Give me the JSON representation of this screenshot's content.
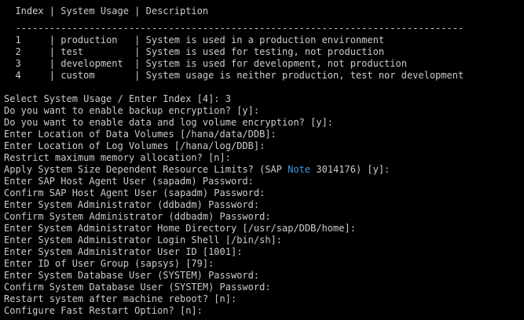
{
  "table": {
    "header": "  Index | System Usage | Description",
    "separator": "  -------------------------------------------------------------------------------",
    "rows": [
      "  1     | production   | System is used in a production environment",
      "  2     | test         | System is used for testing, not production",
      "  3     | development  | System is used for development, not production",
      "  4     | custom       | System usage is neither production, test nor development"
    ]
  },
  "prompts": {
    "select_usage": "Select System Usage / Enter Index [4]: 3",
    "backup_encryption": "Do you want to enable backup encryption? [y]:",
    "volume_encryption": "Do you want to enable data and log volume encryption? [y]:",
    "data_volumes": "Enter Location of Data Volumes [/hana/data/DDB]:",
    "log_volumes": "Enter Location of Log Volumes [/hana/log/DDB]:",
    "restrict_memory": "Restrict maximum memory allocation? [n]:",
    "resource_limits_before": "Apply System Size Dependent Resource Limits? (SAP ",
    "resource_limits_note": "Note",
    "resource_limits_after": " 3014176) [y]:",
    "host_agent_password": "Enter SAP Host Agent User (sapadm) Password:",
    "host_agent_confirm": "Confirm SAP Host Agent User (sapadm) Password:",
    "sysadm_password": "Enter System Administrator (ddbadm) Password:",
    "sysadm_confirm": "Confirm System Administrator (ddbadm) Password:",
    "sysadm_home": "Enter System Administrator Home Directory [/usr/sap/DDB/home]:",
    "sysadm_shell": "Enter System Administrator Login Shell [/bin/sh]:",
    "sysadm_uid": "Enter System Administrator User ID [1001]:",
    "group_id": "Enter ID of User Group (sapsys) [79]:",
    "db_user_password": "Enter System Database User (SYSTEM) Password:",
    "db_user_confirm": "Confirm System Database User (SYSTEM) Password:",
    "restart_after_reboot": "Restart system after machine reboot? [n]:",
    "fast_restart": "Configure Fast Restart Option? [n]:"
  },
  "colors": {
    "background": "#000000",
    "text": "#cccccc",
    "highlight": "#3a96dd"
  }
}
